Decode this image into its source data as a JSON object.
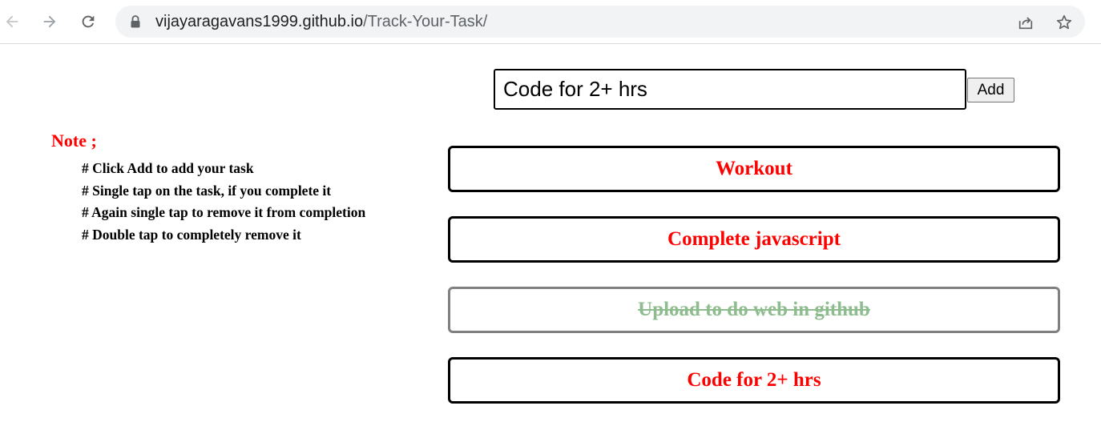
{
  "browser": {
    "url_host": "vijayaragavans1999.github.io",
    "url_path": "/Track-Your-Task/",
    "icons": [
      "back-icon",
      "forward-icon",
      "reload-icon",
      "lock-icon",
      "share-icon",
      "star-icon"
    ]
  },
  "input": {
    "value": "Code for 2+ hrs"
  },
  "add_button": {
    "label": "Add"
  },
  "note": {
    "title": "Note ;",
    "items": [
      "# Click Add to add your task",
      "# Single tap on the task, if you complete it",
      "# Again single tap to remove it from completion",
      "# Double tap to completely remove it"
    ]
  },
  "tasks": [
    {
      "label": "Workout",
      "completed": false
    },
    {
      "label": "Complete javascript",
      "completed": false
    },
    {
      "label": "Upload to do web in github",
      "completed": true
    },
    {
      "label": "Code for 2+ hrs",
      "completed": false
    }
  ],
  "colors": {
    "task_text": "#ff0000",
    "completed_text": "#8fbc8f",
    "completed_border": "#808080",
    "note_title": "#ff0000"
  }
}
